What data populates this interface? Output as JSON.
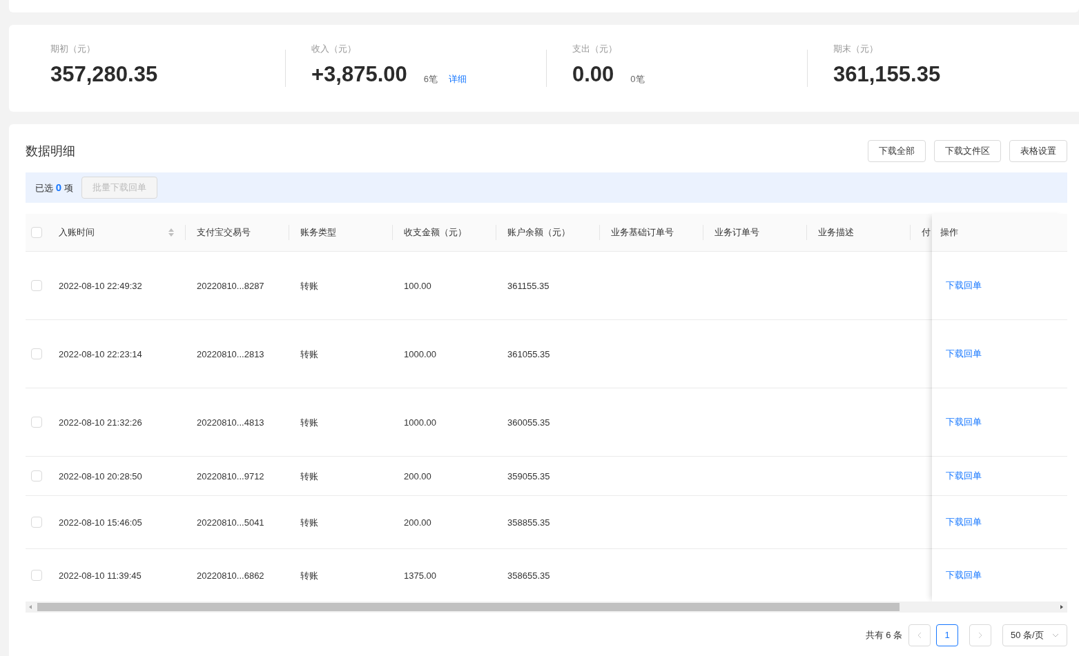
{
  "summary": [
    {
      "label": "期初（元）",
      "value": "357,280.35"
    },
    {
      "label": "收入（元）",
      "value": "+3,875.00",
      "count": "6笔",
      "link": "详细"
    },
    {
      "label": "支出（元）",
      "value": "0.00",
      "count": "0笔"
    },
    {
      "label": "期末（元）",
      "value": "361,155.35"
    }
  ],
  "detail": {
    "title": "数据明细",
    "buttons": [
      "下载全部",
      "下载文件区",
      "表格设置"
    ],
    "selection": {
      "prefix": "已选",
      "count": "0",
      "suffix": "项",
      "batch_button": {
        "label": "批量下载回单",
        "disabled": true
      }
    },
    "table": {
      "header_checked": false,
      "columns": [
        {
          "label": "入账时间",
          "sortable": true
        },
        {
          "label": "支付宝交易号",
          "sortable": false
        },
        {
          "label": "账务类型",
          "sortable": false
        },
        {
          "label": "收支金额（元）",
          "sortable": false
        },
        {
          "label": "账户余额（元）",
          "sortable": false
        },
        {
          "label": "业务基础订单号",
          "sortable": false
        },
        {
          "label": "业务订单号",
          "sortable": false
        },
        {
          "label": "业务描述",
          "sortable": false
        },
        {
          "label": "付",
          "sortable": false
        }
      ],
      "action_column": "操作",
      "rows": [
        {
          "checked": false,
          "cells": [
            "2022-08-10 22:49:32",
            "20220810...8287",
            "转账",
            "100.00",
            "361155.35"
          ],
          "action": "下载回单"
        },
        {
          "checked": false,
          "cells": [
            "2022-08-10 22:23:14",
            "20220810...2813",
            "转账",
            "1000.00",
            "361055.35"
          ],
          "action": "下载回单"
        },
        {
          "checked": false,
          "cells": [
            "2022-08-10 21:32:26",
            "20220810...4813",
            "转账",
            "1000.00",
            "360055.35"
          ],
          "action": "下载回单"
        },
        {
          "checked": false,
          "cells": [
            "2022-08-10 20:28:50",
            "20220810...9712",
            "转账",
            "200.00",
            "359055.35"
          ],
          "action": "下载回单"
        },
        {
          "checked": false,
          "cells": [
            "2022-08-10 15:46:05",
            "20220810...5041",
            "转账",
            "200.00",
            "358855.35"
          ],
          "action": "下载回单"
        },
        {
          "checked": false,
          "cells": [
            "2022-08-10 11:39:45",
            "20220810...6862",
            "转账",
            "1375.00",
            "358655.35"
          ],
          "action": "下载回单"
        }
      ]
    },
    "pagination": {
      "total": "共有 6 条",
      "prev_disabled": true,
      "next_disabled": true,
      "pages": [
        {
          "label": "1",
          "selected": true
        }
      ],
      "page_size": "50 条/页"
    }
  }
}
